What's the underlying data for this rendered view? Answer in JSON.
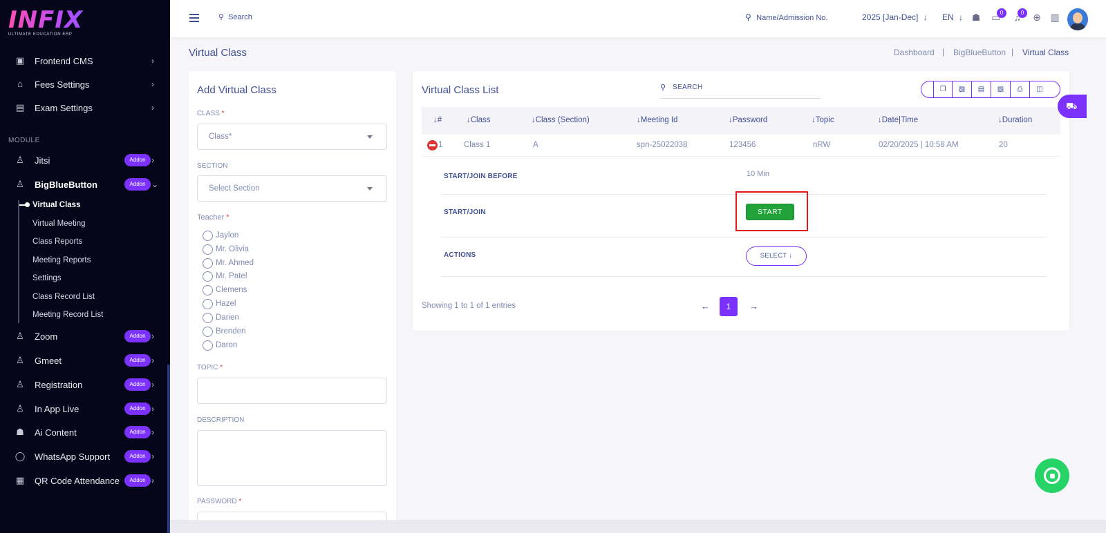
{
  "brand": {
    "logo_text": "INFIX",
    "logo_subtitle": "ULTIMATE EDUCATION ERP"
  },
  "sidebar": {
    "top_items": [
      {
        "label": "Frontend CMS"
      },
      {
        "label": "Fees Settings"
      },
      {
        "label": "Exam Settings"
      }
    ],
    "module_label": "MODULE",
    "addon_label": "Addon",
    "modules": [
      {
        "label": "Jitsi"
      },
      {
        "label": "BigBlueButton"
      },
      {
        "label": "Zoom"
      },
      {
        "label": "Gmeet"
      },
      {
        "label": "Registration"
      },
      {
        "label": "In App Live"
      },
      {
        "label": "Ai Content"
      },
      {
        "label": "WhatsApp Support"
      },
      {
        "label": "QR Code Attendance"
      }
    ],
    "bbb_subitems": [
      {
        "label": "Virtual Class"
      },
      {
        "label": "Virtual Meeting"
      },
      {
        "label": "Class Reports"
      },
      {
        "label": "Meeting Reports"
      },
      {
        "label": "Settings"
      },
      {
        "label": "Class Record List"
      },
      {
        "label": "Meeting Record List"
      }
    ]
  },
  "topbar": {
    "search_placeholder": "Search",
    "admission_search": "Name/Admission No.",
    "session": "2025 [Jan-Dec]",
    "language": "EN",
    "chat_count": "0",
    "notification_count": "0"
  },
  "page": {
    "title": "Virtual Class",
    "breadcrumb": [
      "Dashboard",
      "BigBlueButton",
      "Virtual Class"
    ]
  },
  "form": {
    "title": "Add Virtual Class",
    "class_label": "CLASS",
    "class_placeholder": "Class*",
    "section_label": "SECTION",
    "section_placeholder": "Select Section",
    "teacher_label": "Teacher",
    "teachers": [
      "Jaylon",
      "Mr. Olivia",
      "Mr. Ahmed",
      "Mr. Patel",
      "Clemens",
      "Hazel",
      "Darien",
      "Brenden",
      "Daron"
    ],
    "topic_label": "TOPIC",
    "description_label": "DESCRIPTION",
    "password_label": "PASSWORD",
    "required_mark": "*"
  },
  "list": {
    "title": "Virtual Class List",
    "search_placeholder": "SEARCH",
    "columns": [
      "#",
      "Class",
      "Class (Section)",
      "Meeting Id",
      "Password",
      "Topic",
      "Date|Time",
      "Duration"
    ],
    "rows": [
      {
        "num": "1",
        "class": "Class 1",
        "section": "A",
        "meeting_id": "spn-25022038",
        "password": "123456",
        "topic": "nRW",
        "datetime": "02/20/2025 | 10:58 AM",
        "duration": "20"
      }
    ],
    "detail": {
      "start_join_before_label": "START/JOIN BEFORE",
      "start_join_before_value": "10 Min",
      "start_join_label": "START/JOIN",
      "start_button": "START",
      "actions_label": "ACTIONS",
      "select_button": "SELECT"
    },
    "showing": "Showing 1 to 1 of 1 entries",
    "current_page": "1"
  },
  "colors": {
    "accent": "#7c32ff",
    "sidebar_bg": "#06061a",
    "start_green": "#22a33a",
    "highlight_red": "#e01818",
    "whatsapp": "#25d366"
  }
}
